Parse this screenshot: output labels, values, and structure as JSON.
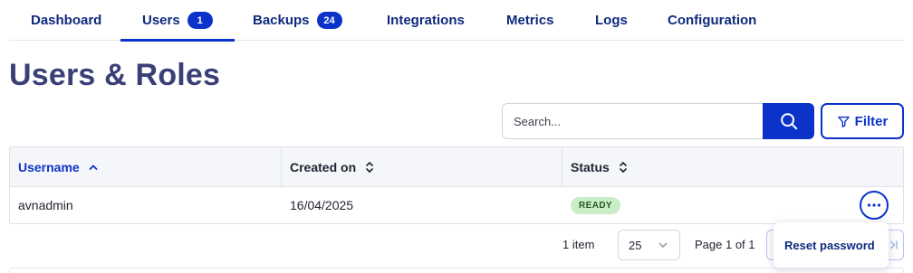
{
  "tabs": [
    {
      "label": "Dashboard"
    },
    {
      "label": "Users",
      "badge": "1",
      "active": true
    },
    {
      "label": "Backups",
      "badge": "24"
    },
    {
      "label": "Integrations"
    },
    {
      "label": "Metrics"
    },
    {
      "label": "Logs"
    },
    {
      "label": "Configuration"
    }
  ],
  "page": {
    "title": "Users & Roles"
  },
  "search": {
    "placeholder": "Search...",
    "value": ""
  },
  "filter": {
    "label": "Filter"
  },
  "table": {
    "columns": [
      {
        "label": "Username",
        "sort": "ascending"
      },
      {
        "label": "Created on",
        "sort": "none"
      },
      {
        "label": "Status",
        "sort": "none"
      }
    ],
    "rows": [
      {
        "username": "avnadmin",
        "created_on": "16/04/2025",
        "status": "READY"
      }
    ]
  },
  "pagination": {
    "count_text": "1 item",
    "page_size": "25",
    "page_text": "Page 1 of 1"
  },
  "row_menu": {
    "items": [
      "Reset password"
    ]
  },
  "colors": {
    "accent": "#0b33c9",
    "title": "#3a3f77",
    "status_ready_bg": "#c9edc7"
  }
}
